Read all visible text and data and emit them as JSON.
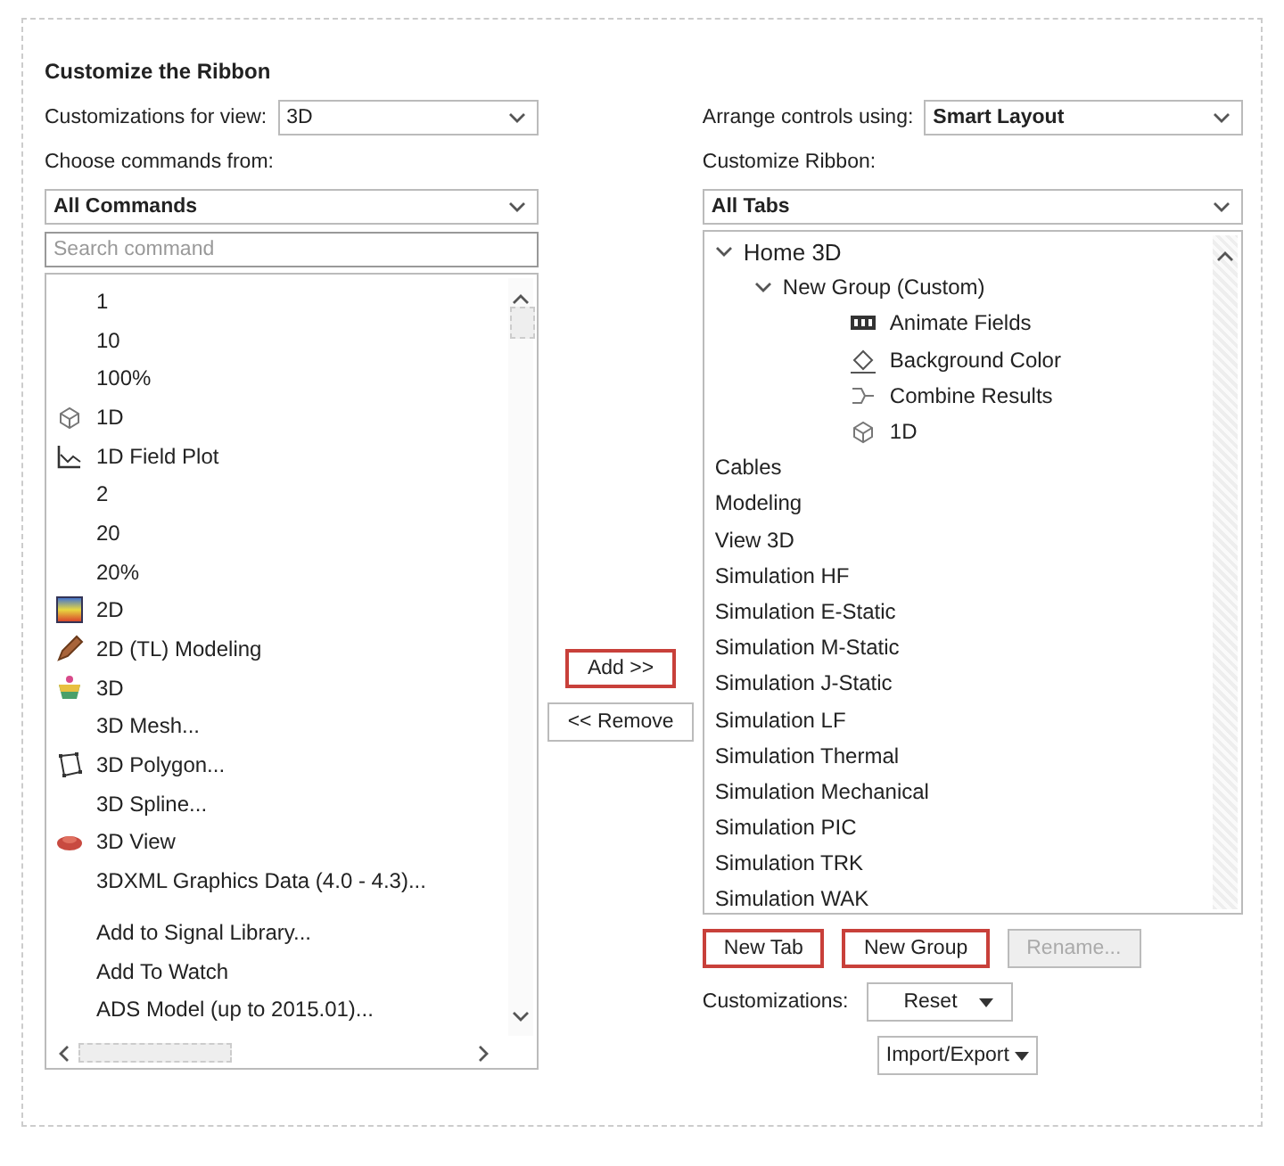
{
  "title": "Customize the Ribbon",
  "view": {
    "label": "Customizations for view:",
    "value": "3D"
  },
  "commands_from": {
    "label": "Choose commands from:",
    "value": "All Commands"
  },
  "search": {
    "placeholder": "Search command"
  },
  "commands": [
    {
      "label": "1",
      "kind": "text"
    },
    {
      "label": "10",
      "kind": "text"
    },
    {
      "label": "100%",
      "kind": "text"
    },
    {
      "label": "1D",
      "kind": "cube"
    },
    {
      "label": "1D Field Plot",
      "kind": "plot"
    },
    {
      "label": "2",
      "kind": "text"
    },
    {
      "label": "20",
      "kind": "text"
    },
    {
      "label": "20%",
      "kind": "text"
    },
    {
      "label": "2D",
      "kind": "gradient"
    },
    {
      "label": "2D (TL) Modeling",
      "kind": "pencil"
    },
    {
      "label": "3D",
      "kind": "cup"
    },
    {
      "label": "3D Mesh...",
      "kind": "text"
    },
    {
      "label": "3D Polygon...",
      "kind": "polygon"
    },
    {
      "label": "3D Spline...",
      "kind": "text"
    },
    {
      "label": "3D View",
      "kind": "eye"
    },
    {
      "label": "3DXML Graphics Data (4.0 - 4.3)...",
      "kind": "text"
    },
    {
      "label": "Add to Signal Library...",
      "kind": "text"
    },
    {
      "label": "Add To Watch",
      "kind": "text"
    },
    {
      "label": "ADS Model (up to 2015.01)...",
      "kind": "text"
    }
  ],
  "move_buttons": [
    {
      "label": "Add >>",
      "highlighted": true
    },
    {
      "label": "<< Remove",
      "highlighted": false
    }
  ],
  "arrange": {
    "label": "Arrange controls using:",
    "value": "Smart Layout"
  },
  "ribbon": {
    "label": "Customize Ribbon:",
    "value": "All Tabs"
  },
  "tabs": [
    {
      "label": "Home 3D",
      "expanded": true,
      "children": [
        {
          "label": "New Group (Custom)",
          "expanded": true,
          "children": [
            {
              "label": "Animate Fields",
              "kind": "film"
            },
            {
              "label": "Background Color",
              "kind": "bucket"
            },
            {
              "label": "Combine Results",
              "kind": "merge"
            },
            {
              "label": "1D",
              "kind": "cube"
            }
          ]
        }
      ]
    },
    {
      "label": "Cables"
    },
    {
      "label": "Modeling"
    },
    {
      "label": "View 3D"
    },
    {
      "label": "Simulation HF"
    },
    {
      "label": "Simulation E-Static"
    },
    {
      "label": "Simulation M-Static"
    },
    {
      "label": "Simulation J-Static"
    },
    {
      "label": "Simulation LF"
    },
    {
      "label": "Simulation Thermal"
    },
    {
      "label": "Simulation Mechanical"
    },
    {
      "label": "Simulation PIC"
    },
    {
      "label": "Simulation TRK"
    },
    {
      "label": "Simulation WAK"
    }
  ],
  "tab_buttons": [
    {
      "label": "New Tab",
      "highlighted": true,
      "disabled": false
    },
    {
      "label": "New Group",
      "highlighted": true,
      "disabled": false
    },
    {
      "label": "Rename...",
      "highlighted": false,
      "disabled": true
    }
  ],
  "customizations": {
    "label": "Customizations:",
    "reset": "Reset",
    "import_export": "Import/Export"
  }
}
